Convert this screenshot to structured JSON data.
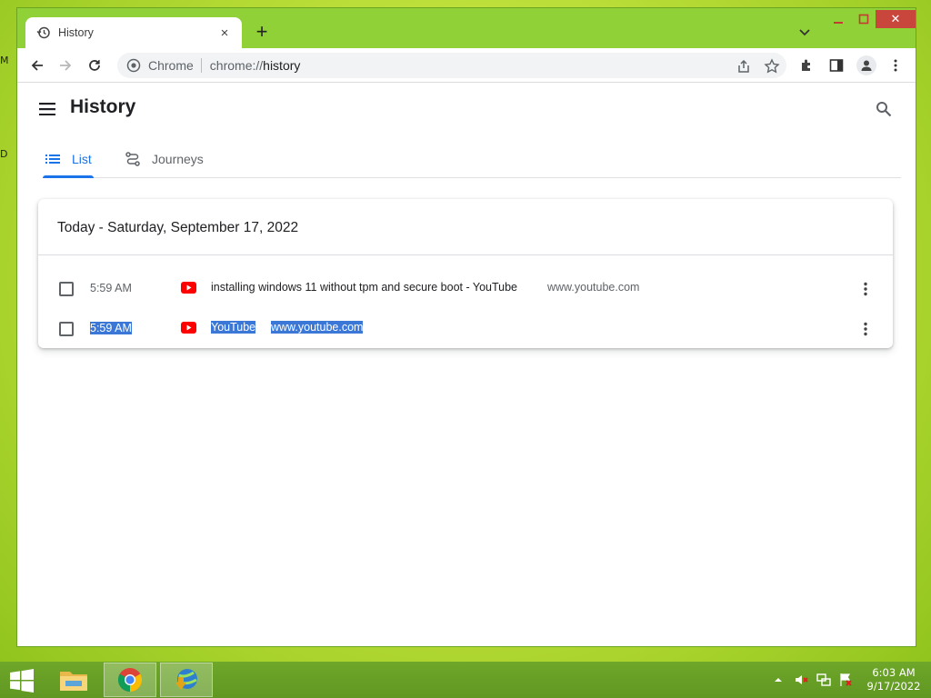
{
  "desktop": {
    "labels": [
      "M",
      "D"
    ]
  },
  "browser": {
    "tab": {
      "title": "History",
      "close": "×"
    },
    "new_tab": "+",
    "window_controls": {
      "minimize": "—",
      "maximize": "□",
      "close": "✕"
    },
    "omnibox": {
      "chip": "Chrome",
      "url_scheme": "chrome://",
      "url_path": "history"
    }
  },
  "page": {
    "title": "History",
    "tabs": [
      {
        "label": "List",
        "active": true
      },
      {
        "label": "Journeys",
        "active": false
      }
    ],
    "group": {
      "date": "Today - Saturday, September 17, 2022",
      "entries": [
        {
          "time": "5:59 AM",
          "title": "installing windows 11 without tpm and secure boot - YouTube",
          "domain": "www.youtube.com",
          "selected": false
        },
        {
          "time": "5:59 AM",
          "title": "YouTube",
          "domain": "www.youtube.com",
          "selected": true
        }
      ]
    }
  },
  "taskbar": {
    "apps": [
      "file-explorer",
      "google-chrome",
      "internet-download-manager"
    ],
    "clock": {
      "time": "6:03 AM",
      "date": "9/17/2022"
    }
  },
  "colors": {
    "accent": "#1a73e8",
    "selection": "#3a77d6",
    "youtube": "#ff0000",
    "window_frame": "#8fd136"
  }
}
